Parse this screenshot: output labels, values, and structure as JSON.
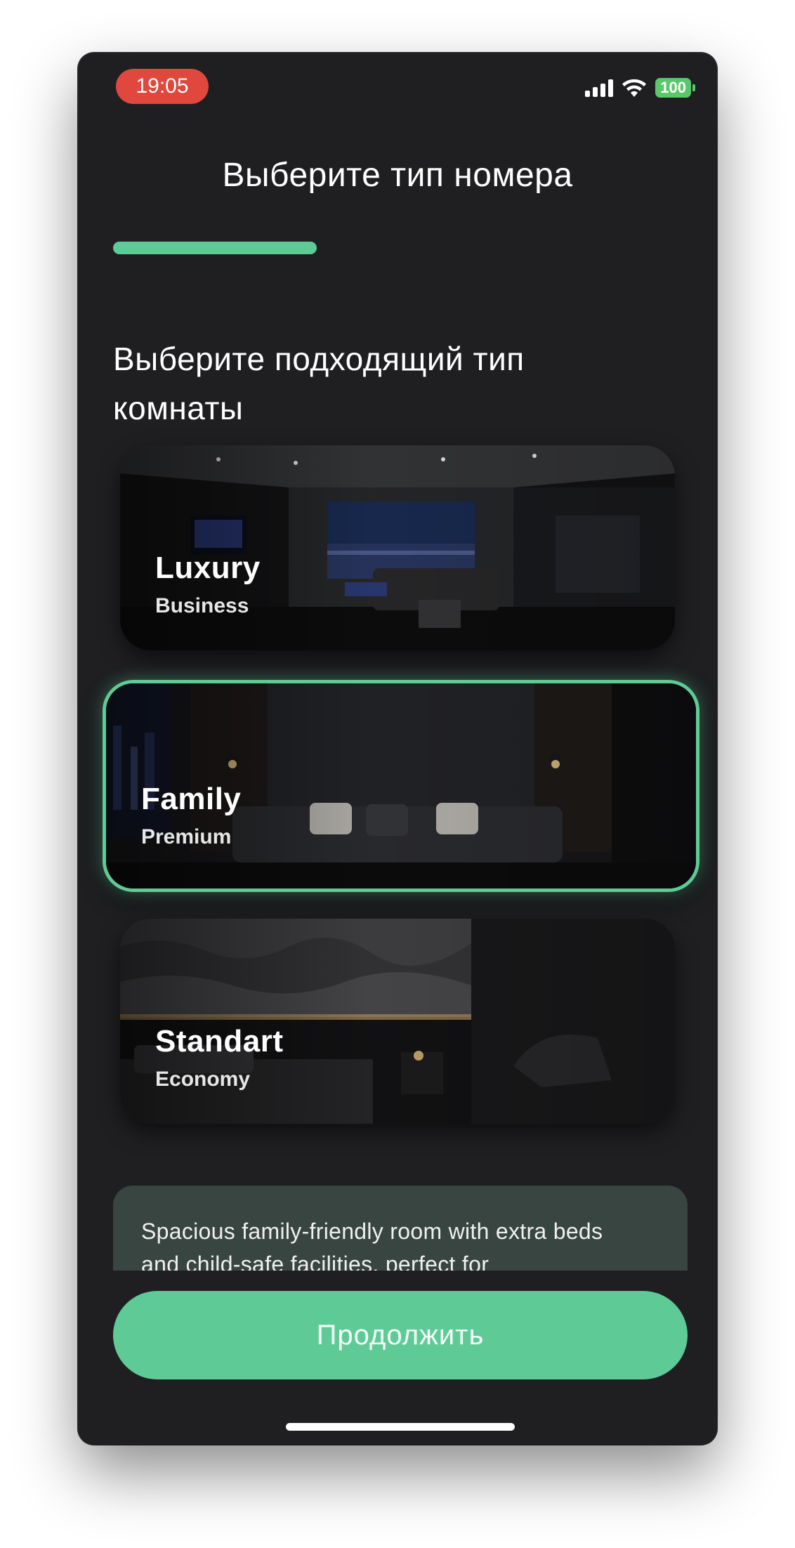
{
  "status_bar": {
    "time": "19:05",
    "battery": "100",
    "icons": [
      "signal-icon",
      "wifi-icon",
      "battery-icon"
    ]
  },
  "header": {
    "title": "Выберите тип номера"
  },
  "progress": {
    "fraction": 0.5
  },
  "subtitle": "Выберите подходящий тип комнаты",
  "rooms": [
    {
      "name": "Luxury",
      "tier": "Business",
      "selected": false
    },
    {
      "name": "Family",
      "tier": "Premium",
      "selected": true
    },
    {
      "name": "Standart",
      "tier": "Economy",
      "selected": false
    }
  ],
  "description": "Spacious family-friendly room with extra beds and child-safe facilities, perfect for",
  "continue_label": "Продолжить",
  "colors": {
    "accent": "#5ecb96",
    "background": "#1f1f22",
    "time_pill": "#e0473d",
    "description_bg": "#384541"
  }
}
